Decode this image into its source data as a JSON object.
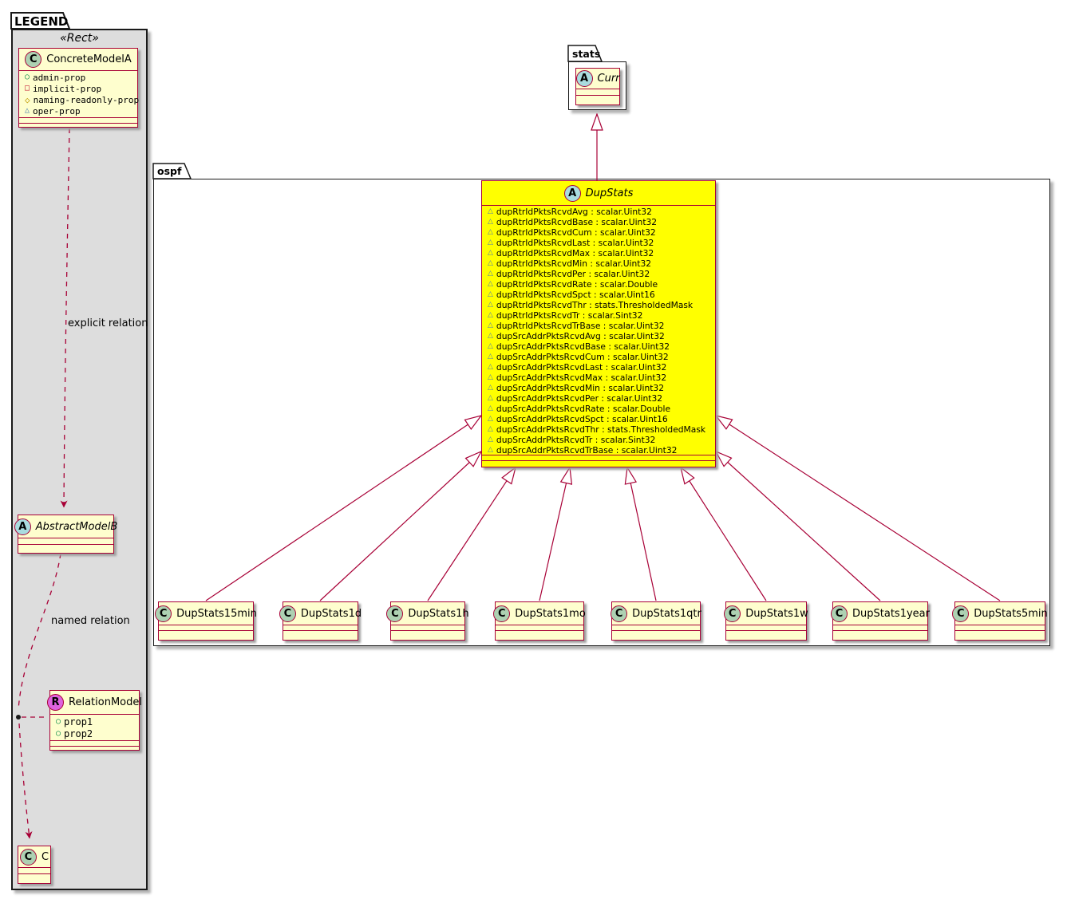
{
  "colors": {
    "class_border": "#A80036",
    "class_fill": "#FEFECE",
    "highlight_fill": "#FFFF00",
    "legend_fill": "#DDDDDD",
    "package_border": "#1a1a1a",
    "class_spot_fill": "#ADD1B2",
    "abstract_spot_fill": "#A9DCDF",
    "relation_spot_fill": "#DE63DE",
    "relation_line": "#A80036"
  },
  "legend": {
    "tab_label": "LEGEND",
    "stereotype": "«Rect»",
    "concrete_model": {
      "spot_letter": "C",
      "name": "ConcreteModelA",
      "properties": [
        {
          "icon": "admin-circle-icon",
          "glyph": "○",
          "label": "admin-prop"
        },
        {
          "icon": "implicit-square-icon",
          "glyph": "□",
          "label": "implicit-prop"
        },
        {
          "icon": "naming-diamond-icon",
          "glyph": "◇",
          "label": "naming-readonly-prop"
        },
        {
          "icon": "oper-triangle-icon",
          "glyph": "△",
          "label": "oper-prop"
        }
      ]
    },
    "explicit_relation_label": "explicit relation",
    "abstract_model": {
      "spot_letter": "A",
      "name": "AbstractModelB"
    },
    "named_relation_label": "named relation",
    "relation_model": {
      "spot_letter": "R",
      "name": "RelationModel",
      "properties": [
        "prop1",
        "prop2"
      ]
    },
    "class_c": {
      "spot_letter": "C",
      "name": "C"
    }
  },
  "stats_package": {
    "tab_label": "stats",
    "curr": {
      "spot_letter": "A",
      "name": "Curr"
    }
  },
  "ospf_package": {
    "tab_label": "ospf",
    "dup_stats": {
      "spot_letter": "A",
      "name": "DupStats",
      "attributes": [
        "dupRtrIdPktsRcvdAvg : scalar.Uint32",
        "dupRtrIdPktsRcvdBase : scalar.Uint32",
        "dupRtrIdPktsRcvdCum : scalar.Uint32",
        "dupRtrIdPktsRcvdLast : scalar.Uint32",
        "dupRtrIdPktsRcvdMax : scalar.Uint32",
        "dupRtrIdPktsRcvdMin : scalar.Uint32",
        "dupRtrIdPktsRcvdPer : scalar.Uint32",
        "dupRtrIdPktsRcvdRate : scalar.Double",
        "dupRtrIdPktsRcvdSpct : scalar.Uint16",
        "dupRtrIdPktsRcvdThr : stats.ThresholdedMask",
        "dupRtrIdPktsRcvdTr : scalar.Sint32",
        "dupRtrIdPktsRcvdTrBase : scalar.Uint32",
        "dupSrcAddrPktsRcvdAvg : scalar.Uint32",
        "dupSrcAddrPktsRcvdBase : scalar.Uint32",
        "dupSrcAddrPktsRcvdCum : scalar.Uint32",
        "dupSrcAddrPktsRcvdLast : scalar.Uint32",
        "dupSrcAddrPktsRcvdMax : scalar.Uint32",
        "dupSrcAddrPktsRcvdMin : scalar.Uint32",
        "dupSrcAddrPktsRcvdPer : scalar.Uint32",
        "dupSrcAddrPktsRcvdRate : scalar.Double",
        "dupSrcAddrPktsRcvdSpct : scalar.Uint16",
        "dupSrcAddrPktsRcvdThr : stats.ThresholdedMask",
        "dupSrcAddrPktsRcvdTr : scalar.Sint32",
        "dupSrcAddrPktsRcvdTrBase : scalar.Uint32"
      ]
    },
    "subclasses": [
      {
        "spot_letter": "C",
        "name": "DupStats15min"
      },
      {
        "spot_letter": "C",
        "name": "DupStats1d"
      },
      {
        "spot_letter": "C",
        "name": "DupStats1h"
      },
      {
        "spot_letter": "C",
        "name": "DupStats1mo"
      },
      {
        "spot_letter": "C",
        "name": "DupStats1qtr"
      },
      {
        "spot_letter": "C",
        "name": "DupStats1w"
      },
      {
        "spot_letter": "C",
        "name": "DupStats1year"
      },
      {
        "spot_letter": "C",
        "name": "DupStats5min"
      }
    ]
  }
}
